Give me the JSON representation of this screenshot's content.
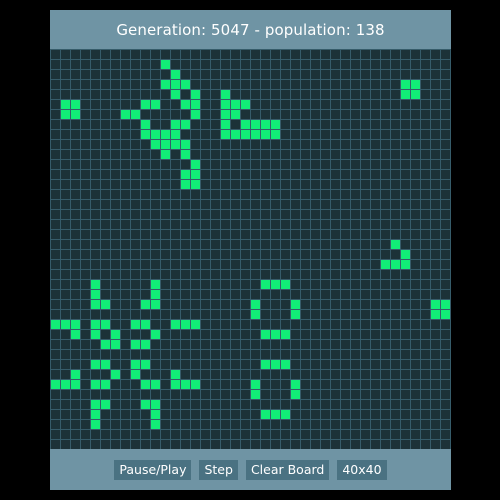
{
  "header": {
    "generation_label": "Generation:",
    "generation": "5047",
    "separator": "-",
    "population_label": "population:",
    "population": "138"
  },
  "controls": {
    "pause_play": "Pause/Play",
    "step": "Step",
    "clear_board": "Clear Board",
    "size": "40x40"
  },
  "board": {
    "columns": 40,
    "rows": 40,
    "colors": {
      "background": "#1c3238",
      "grid_line": "#365c6a",
      "live_cell": "#12ee77",
      "frame": "#6f94a4"
    },
    "live_cells": [
      [
        11,
        1
      ],
      [
        12,
        2
      ],
      [
        11,
        3
      ],
      [
        12,
        3
      ],
      [
        13,
        3
      ],
      [
        12,
        4
      ],
      [
        14,
        4
      ],
      [
        13,
        5
      ],
      [
        14,
        5
      ],
      [
        14,
        6
      ],
      [
        13,
        7
      ],
      [
        12,
        8
      ],
      [
        11,
        8
      ],
      [
        12,
        7
      ],
      [
        13,
        13
      ],
      [
        14,
        12
      ],
      [
        13,
        12
      ],
      [
        14,
        11
      ],
      [
        14,
        13
      ],
      [
        17,
        4
      ],
      [
        17,
        5
      ],
      [
        17,
        6
      ],
      [
        17,
        7
      ],
      [
        17,
        8
      ],
      [
        18,
        5
      ],
      [
        18,
        6
      ],
      [
        18,
        8
      ],
      [
        19,
        5
      ],
      [
        19,
        7
      ],
      [
        19,
        8
      ],
      [
        20,
        7
      ],
      [
        20,
        8
      ],
      [
        21,
        7
      ],
      [
        21,
        8
      ],
      [
        22,
        7
      ],
      [
        22,
        8
      ],
      [
        35,
        3
      ],
      [
        36,
        3
      ],
      [
        35,
        4
      ],
      [
        36,
        4
      ],
      [
        1,
        5
      ],
      [
        2,
        5
      ],
      [
        1,
        6
      ],
      [
        2,
        6
      ],
      [
        7,
        6
      ],
      [
        8,
        6
      ],
      [
        9,
        7
      ],
      [
        9,
        5
      ],
      [
        10,
        5
      ],
      [
        9,
        8
      ],
      [
        10,
        8
      ],
      [
        10,
        9
      ],
      [
        11,
        9
      ],
      [
        11,
        10
      ],
      [
        12,
        9
      ],
      [
        13,
        9
      ],
      [
        13,
        10
      ],
      [
        34,
        19
      ],
      [
        35,
        20
      ],
      [
        33,
        21
      ],
      [
        34,
        21
      ],
      [
        35,
        21
      ],
      [
        38,
        25
      ],
      [
        39,
        25
      ],
      [
        38,
        26
      ],
      [
        39,
        26
      ],
      [
        4,
        23
      ],
      [
        4,
        24
      ],
      [
        4,
        25
      ],
      [
        5,
        25
      ],
      [
        10,
        23
      ],
      [
        10,
        24
      ],
      [
        9,
        25
      ],
      [
        10,
        25
      ],
      [
        0,
        27
      ],
      [
        1,
        27
      ],
      [
        2,
        27
      ],
      [
        2,
        28
      ],
      [
        12,
        27
      ],
      [
        13,
        27
      ],
      [
        14,
        27
      ],
      [
        4,
        27
      ],
      [
        5,
        27
      ],
      [
        4,
        28
      ],
      [
        6,
        28
      ],
      [
        5,
        29
      ],
      [
        6,
        29
      ],
      [
        8,
        27
      ],
      [
        9,
        27
      ],
      [
        10,
        28
      ],
      [
        8,
        29
      ],
      [
        9,
        29
      ],
      [
        4,
        31
      ],
      [
        5,
        31
      ],
      [
        6,
        32
      ],
      [
        4,
        33
      ],
      [
        5,
        33
      ],
      [
        8,
        31
      ],
      [
        9,
        31
      ],
      [
        8,
        32
      ],
      [
        10,
        33
      ],
      [
        9,
        33
      ],
      [
        0,
        33
      ],
      [
        1,
        33
      ],
      [
        2,
        32
      ],
      [
        2,
        33
      ],
      [
        12,
        32
      ],
      [
        12,
        33
      ],
      [
        13,
        33
      ],
      [
        14,
        33
      ],
      [
        4,
        35
      ],
      [
        5,
        35
      ],
      [
        4,
        36
      ],
      [
        4,
        37
      ],
      [
        9,
        35
      ],
      [
        10,
        35
      ],
      [
        10,
        36
      ],
      [
        10,
        37
      ],
      [
        21,
        23
      ],
      [
        22,
        23
      ],
      [
        23,
        23
      ],
      [
        20,
        25
      ],
      [
        24,
        25
      ],
      [
        20,
        26
      ],
      [
        24,
        26
      ],
      [
        21,
        28
      ],
      [
        22,
        28
      ],
      [
        23,
        28
      ],
      [
        21,
        31
      ],
      [
        22,
        31
      ],
      [
        23,
        31
      ],
      [
        20,
        33
      ],
      [
        24,
        33
      ],
      [
        20,
        34
      ],
      [
        24,
        34
      ],
      [
        21,
        36
      ],
      [
        22,
        36
      ],
      [
        23,
        36
      ]
    ]
  }
}
